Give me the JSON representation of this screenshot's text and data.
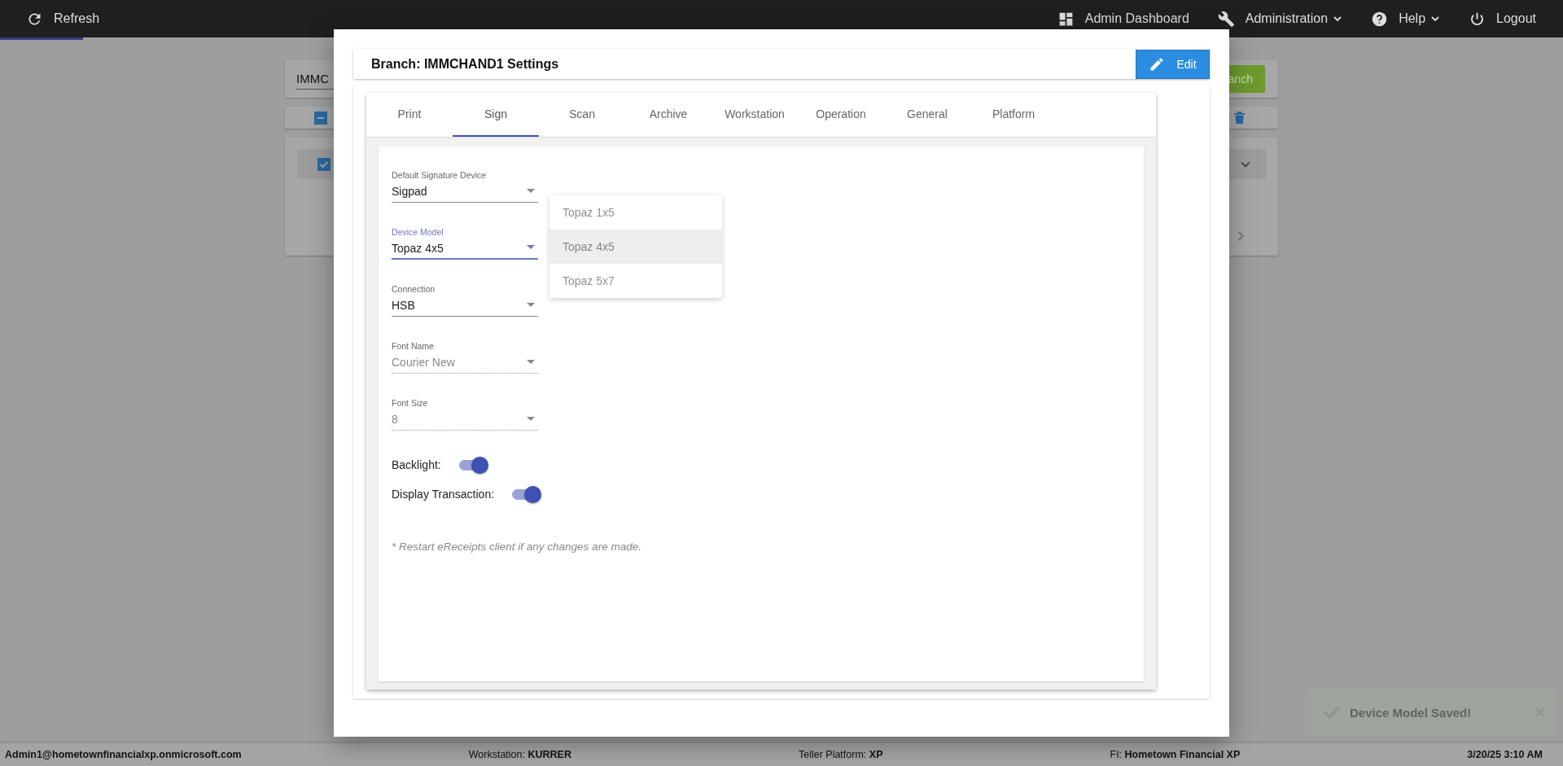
{
  "top_bar": {
    "refresh": "Refresh",
    "menu": [
      {
        "kind": "dashboard",
        "label": "Admin Dashboard",
        "caret": false
      },
      {
        "kind": "wrench",
        "label": "Administration",
        "caret": true
      },
      {
        "kind": "help",
        "label": "Help",
        "caret": true
      },
      {
        "kind": "power",
        "label": "Logout",
        "caret": false
      }
    ]
  },
  "background": {
    "search_value": "IMMC",
    "branch_button": "anch",
    "header_checkbox": {
      "indeterminate": true
    },
    "row_checkbox": {
      "checked": true
    }
  },
  "modal": {
    "title": "Branch: IMMCHAND1 Settings",
    "edit_button": "Edit",
    "tabs": [
      {
        "label": "Print",
        "selected": false
      },
      {
        "label": "Sign",
        "selected": true
      },
      {
        "label": "Scan",
        "selected": false
      },
      {
        "label": "Archive",
        "selected": false
      },
      {
        "label": "Workstation",
        "selected": false
      },
      {
        "label": "Operation",
        "selected": false
      },
      {
        "label": "General",
        "selected": false
      },
      {
        "label": "Platform",
        "selected": false
      }
    ],
    "fields": [
      {
        "label": "Default Signature Device",
        "value": "Sigpad",
        "focused": false,
        "disabled": false
      },
      {
        "label": "Device Model",
        "value": "Topaz 4x5",
        "focused": true,
        "disabled": false
      },
      {
        "label": "Connection",
        "value": "HSB",
        "focused": false,
        "disabled": false
      },
      {
        "label": "Font Name",
        "value": "Courier New",
        "focused": false,
        "disabled": true
      },
      {
        "label": "Font Size",
        "value": "8",
        "focused": false,
        "disabled": true
      }
    ],
    "dropdown_menu": [
      {
        "label": "Topaz 1x5",
        "selected": false
      },
      {
        "label": "Topaz 4x5",
        "selected": true
      },
      {
        "label": "Topaz 5x7",
        "selected": false
      }
    ],
    "toggles": [
      {
        "label": "Backlight:",
        "on": true
      },
      {
        "label": "Display Transaction:",
        "on": true
      }
    ],
    "note": "* Restart eReceipts client if any changes are made."
  },
  "toast": {
    "message": "Device Model Saved!"
  },
  "status_bar": {
    "user": "Admin1@hometownfinancialxp.onmicrosoft.com",
    "items": [
      {
        "label": "Workstation:",
        "value": "KURRER"
      },
      {
        "label": "Teller Platform:",
        "value": "XP"
      },
      {
        "label": "FI:",
        "value": "Hometown Financial XP"
      }
    ],
    "datetime": "3/20/25 3:10 AM"
  }
}
